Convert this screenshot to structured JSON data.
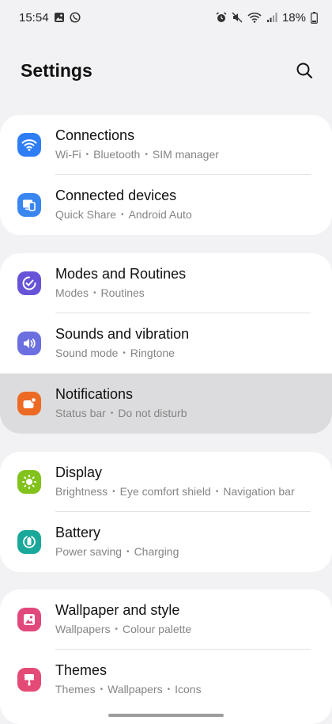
{
  "status_bar": {
    "time": "15:54",
    "battery": "18%",
    "left_icons": [
      "gallery-notification-icon",
      "whatsapp-notification-icon"
    ],
    "right_icons": [
      "alarm-icon",
      "mute-icon",
      "wifi-icon",
      "signal-icon",
      "battery-icon"
    ]
  },
  "header": {
    "title": "Settings",
    "search_icon": "search-icon"
  },
  "groups": [
    {
      "items": [
        {
          "title": "Connections",
          "subtitle": [
            "Wi-Fi",
            "Bluetooth",
            "SIM manager"
          ],
          "icon": "wifi-icon",
          "color": "#2f7df5"
        },
        {
          "title": "Connected devices",
          "subtitle": [
            "Quick Share",
            "Android Auto"
          ],
          "icon": "connected-devices-icon",
          "color": "#3a86f0"
        }
      ]
    },
    {
      "items": [
        {
          "title": "Modes and Routines",
          "subtitle": [
            "Modes",
            "Routines"
          ],
          "icon": "modes-routines-icon",
          "color": "#6753d8"
        },
        {
          "title": "Sounds and vibration",
          "subtitle": [
            "Sound mode",
            "Ringtone"
          ],
          "icon": "volume-icon",
          "color": "#6b6fe0"
        },
        {
          "title": "Notifications",
          "subtitle": [
            "Status bar",
            "Do not disturb"
          ],
          "icon": "notifications-icon",
          "color": "#ec6a24",
          "highlighted": true
        }
      ]
    },
    {
      "items": [
        {
          "title": "Display",
          "subtitle": [
            "Brightness",
            "Eye comfort shield",
            "Navigation bar"
          ],
          "icon": "brightness-icon",
          "color": "#82c21c"
        },
        {
          "title": "Battery",
          "subtitle": [
            "Power saving",
            "Charging"
          ],
          "icon": "battery-settings-icon",
          "color": "#1aa89a"
        }
      ]
    },
    {
      "items": [
        {
          "title": "Wallpaper and style",
          "subtitle": [
            "Wallpapers",
            "Colour palette"
          ],
          "icon": "wallpaper-icon",
          "color": "#e1487c"
        },
        {
          "title": "Themes",
          "subtitle": [
            "Themes",
            "Wallpapers",
            "Icons"
          ],
          "icon": "themes-icon",
          "color": "#e44a76"
        }
      ]
    }
  ]
}
